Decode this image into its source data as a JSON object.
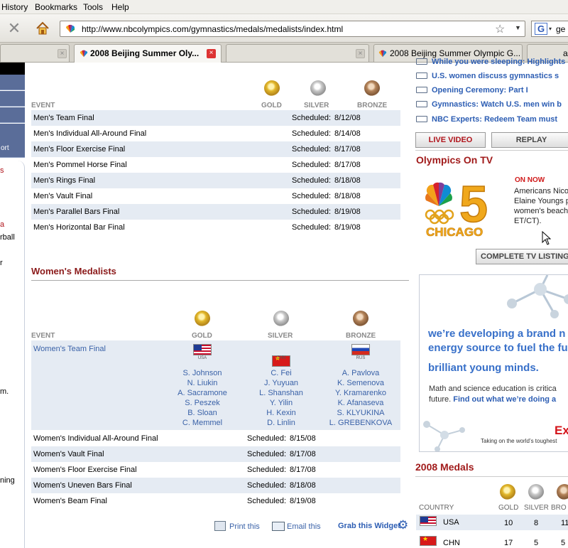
{
  "browser": {
    "menu": [
      "History",
      "Bookmarks",
      "Tools",
      "Help"
    ],
    "url": "http://www.nbcolympics.com/gymnastics/medals/medalists/index.html",
    "search_text": "ge",
    "tabs": [
      {
        "label": "",
        "active": false
      },
      {
        "label": "2008 Beijing Summer Oly...",
        "active": true
      },
      {
        "label": "",
        "active": false
      },
      {
        "label": "2008 Beijing Summer Olympic G...",
        "active": false
      },
      {
        "label": "a",
        "active": false
      }
    ]
  },
  "sidebar": {
    "items": [
      "",
      "",
      "",
      "",
      "ort"
    ],
    "fragments": [
      "s",
      "a",
      "rball",
      "r",
      "m.",
      "ning"
    ]
  },
  "mens": {
    "col_event": "EVENT",
    "col_gold": "GOLD",
    "col_silver": "SILVER",
    "col_bronze": "BRONZE",
    "rows": [
      {
        "event": "Men's Team Final",
        "status": "Scheduled:",
        "date": "8/12/08"
      },
      {
        "event": "Men's Individual All-Around Final",
        "status": "Scheduled:",
        "date": "8/14/08"
      },
      {
        "event": "Men's Floor Exercise Final",
        "status": "Scheduled:",
        "date": "8/17/08"
      },
      {
        "event": "Men's Pommel Horse Final",
        "status": "Scheduled:",
        "date": "8/17/08"
      },
      {
        "event": "Men's Rings Final",
        "status": "Scheduled:",
        "date": "8/18/08"
      },
      {
        "event": "Men's Vault Final",
        "status": "Scheduled:",
        "date": "8/18/08"
      },
      {
        "event": "Men's Parallel Bars Final",
        "status": "Scheduled:",
        "date": "8/19/08"
      },
      {
        "event": "Men's Horizontal Bar Final",
        "status": "Scheduled:",
        "date": "8/19/08"
      }
    ]
  },
  "womens": {
    "title": "Women's Medalists",
    "col_event": "EVENT",
    "col_gold": "GOLD",
    "col_silver": "SILVER",
    "col_bronze": "BRONZE",
    "team_final": {
      "event": "Women's Team Final",
      "gold": {
        "country": "USA",
        "athletes": [
          "S. Johnson",
          "N. Liukin",
          "A. Sacramone",
          "S. Peszek",
          "B. Sloan",
          "C. Memmel"
        ]
      },
      "silver": {
        "country": "CHN",
        "athletes": [
          "C. Fei",
          "J. Yuyuan",
          "L. Shanshan",
          "Y. Yilin",
          "H. Kexin",
          "D. Linlin"
        ]
      },
      "bronze": {
        "country": "RUS",
        "athletes": [
          "A. Pavlova",
          "K. Semenova",
          "Y. Kramarenko",
          "K. Afanaseva",
          "S. KLYUKINA",
          "L. GREBENKOVA"
        ]
      }
    },
    "rows": [
      {
        "event": "Women's Individual All-Around Final",
        "status": "Scheduled:",
        "date": "8/15/08"
      },
      {
        "event": "Women's Vault Final",
        "status": "Scheduled:",
        "date": "8/17/08"
      },
      {
        "event": "Women's Floor Exercise Final",
        "status": "Scheduled:",
        "date": "8/17/08"
      },
      {
        "event": "Women's Uneven Bars Final",
        "status": "Scheduled:",
        "date": "8/18/08"
      },
      {
        "event": "Women's Beam Final",
        "status": "Scheduled:",
        "date": "8/19/08"
      }
    ]
  },
  "footer_links": {
    "print": "Print this",
    "email": "Email this",
    "widget": "Grab this Widget"
  },
  "right": {
    "news": [
      "While you were sleeping: Highlights",
      "U.S. women discuss gymnastics s",
      "Opening Ceremony: Part I",
      "Gymnastics: Watch U.S. men win b",
      "NBC Experts: Redeem Team must"
    ],
    "live_video": "LIVE VIDEO",
    "replay": "REPLAY",
    "tv_title": "Olympics On TV",
    "station": {
      "number": "5",
      "city": "CHICAGO"
    },
    "on_now": "ON NOW",
    "tv_lines": [
      "Americans Nico",
      "Elaine Youngs p",
      "women's beach",
      "ET/CT)."
    ],
    "tv_listings": "COMPLETE TV LISTING",
    "ad": {
      "line1": "we’re developing a brand n",
      "line2": "energy source to fuel the fu",
      "line3": "brilliant young minds.",
      "body1": "Math and science education is critica",
      "body2_plain": "future. ",
      "body2_link": "Find out what we’re doing a",
      "logo": "Ex",
      "tagline": "Taking on the world’s toughest"
    },
    "medals_title": "2008 Medals",
    "medals_cols": {
      "country": "COUNTRY",
      "gold": "GOLD",
      "silver": "SILVER",
      "bronze": "BRO"
    },
    "medals_rows": [
      {
        "code": "USA",
        "gold": "10",
        "silver": "8",
        "bronze": "11"
      },
      {
        "code": "CHN",
        "gold": "17",
        "silver": "5",
        "bronze": "5"
      }
    ]
  }
}
